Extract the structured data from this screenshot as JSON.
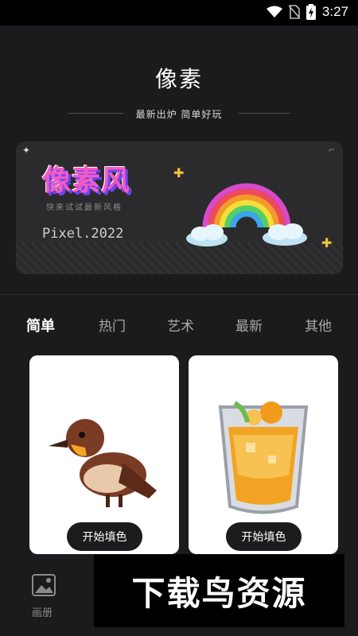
{
  "status_bar": {
    "time": "3:27"
  },
  "header": {
    "title": "像素",
    "subtitle": "最新出炉 简单好玩"
  },
  "banner": {
    "logo_text": "像素风",
    "tagline": "快来试试最新风格",
    "version_text": "Pixel.2022"
  },
  "tabs": [
    {
      "label": "简单",
      "active": true
    },
    {
      "label": "热门",
      "active": false
    },
    {
      "label": "艺术",
      "active": false
    },
    {
      "label": "最新",
      "active": false
    },
    {
      "label": "其他",
      "active": false
    }
  ],
  "cards": [
    {
      "subject": "bird",
      "button_label": "开始填色"
    },
    {
      "subject": "orange-drink",
      "button_label": "开始填色"
    }
  ],
  "bottom_nav": {
    "album_label": "画册"
  },
  "watermark": {
    "text": "下载鸟资源"
  },
  "colors": {
    "background": "#1b1b1d",
    "card": "#ffffff",
    "accent": "#f0c43a"
  }
}
